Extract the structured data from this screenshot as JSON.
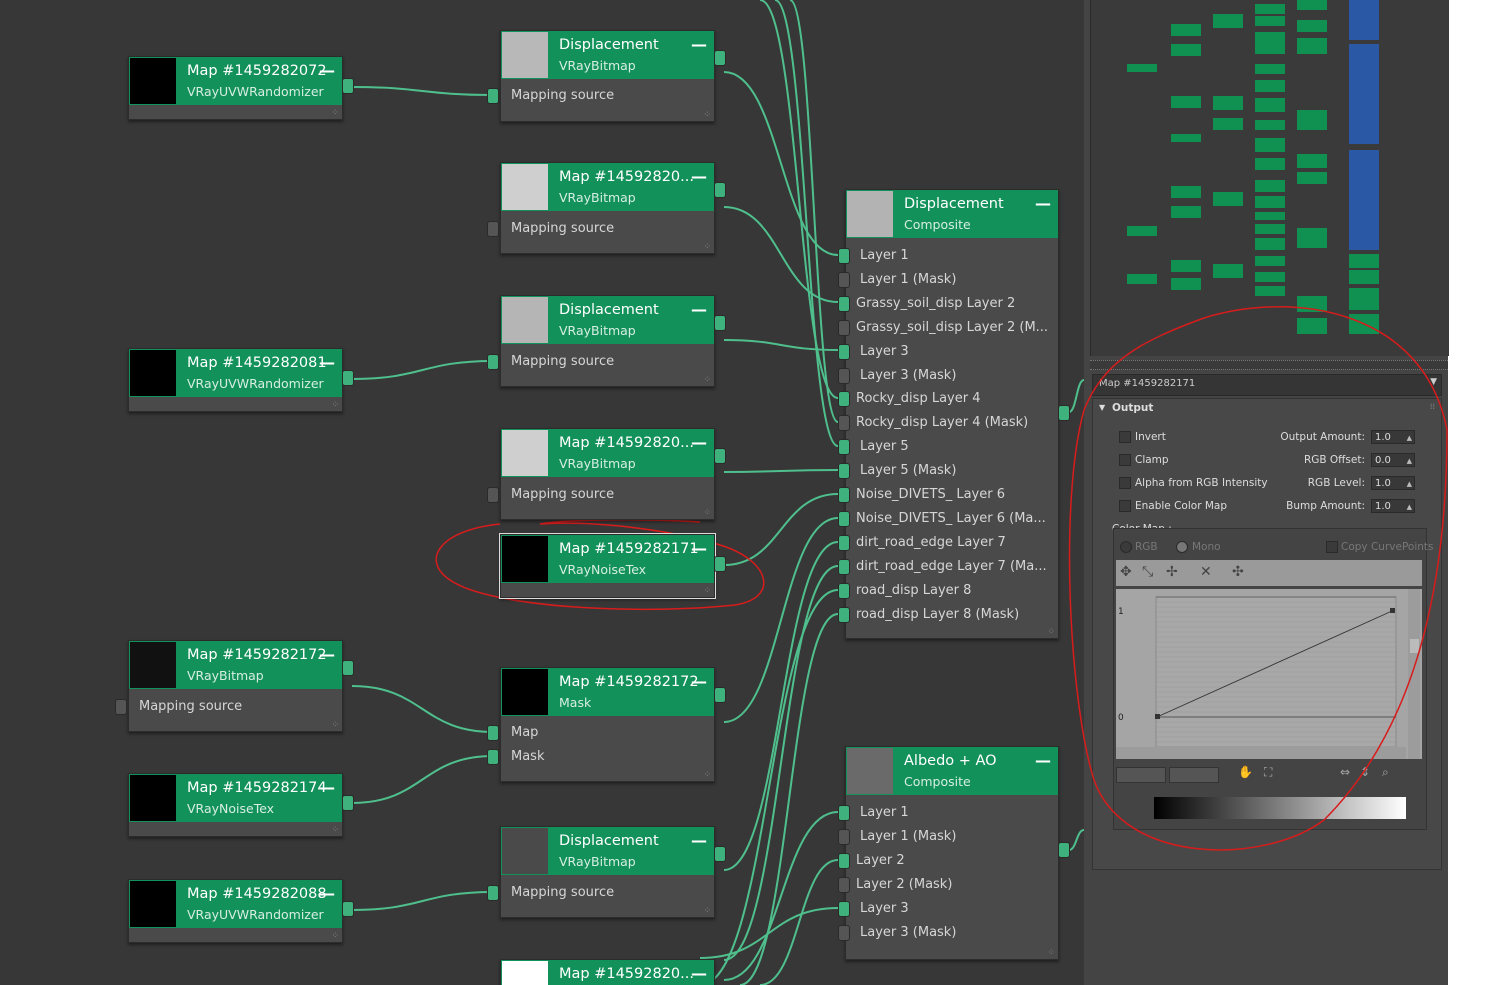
{
  "nodes": [
    {
      "title": "Map #1459282072",
      "subtitle": "VRayUVWRandomizer",
      "rows": []
    },
    {
      "title": "Displacement",
      "subtitle": "VRayBitmap",
      "rows": [
        "Mapping source"
      ]
    },
    {
      "title": "Map #14592820...",
      "subtitle": "VRayBitmap",
      "rows": [
        "Mapping source"
      ]
    },
    {
      "title": "Displacement",
      "subtitle": "VRayBitmap",
      "rows": [
        "Mapping source"
      ]
    },
    {
      "title": "Map #1459282081",
      "subtitle": "VRayUVWRandomizer",
      "rows": []
    },
    {
      "title": "Map #14592820...",
      "subtitle": "VRayBitmap",
      "rows": [
        "Mapping source"
      ]
    },
    {
      "title": "Map #1459282171",
      "subtitle": "VRayNoiseTex",
      "rows": []
    },
    {
      "title": "Map #1459282172",
      "subtitle": "VRayBitmap",
      "rows": [
        "Mapping source"
      ]
    },
    {
      "title": "Map #1459282172",
      "subtitle": "Mask",
      "rows": [
        "Map",
        "Mask"
      ]
    },
    {
      "title": "Map #1459282174",
      "subtitle": "VRayNoiseTex",
      "rows": []
    },
    {
      "title": "Displacement",
      "subtitle": "VRayBitmap",
      "rows": [
        "Mapping source"
      ]
    },
    {
      "title": "Map #1459282088",
      "subtitle": "VRayUVWRandomizer",
      "rows": []
    },
    {
      "title": "Map #14592820...",
      "subtitle": "",
      "rows": []
    },
    {
      "title": "Displacement",
      "subtitle": "Composite",
      "rows": [
        "Layer 1",
        "Layer 1 (Mask)",
        "Grassy_soil_disp Layer 2",
        "Grassy_soil_disp Layer 2 (M...",
        "Layer 3",
        "Layer 3 (Mask)",
        "Rocky_disp Layer 4",
        "Rocky_disp Layer 4 (Mask)",
        "Layer 5",
        "Layer 5 (Mask)",
        "Noise_DIVETS_ Layer 6",
        "Noise_DIVETS_ Layer 6 (Ma...",
        "dirt_road_edge Layer 7",
        "dirt_road_edge Layer 7 (Ma...",
        "road_disp Layer 8",
        "road_disp Layer 8 (Mask)"
      ]
    },
    {
      "title": "Albedo + AO",
      "subtitle": "Composite",
      "rows": [
        "Layer 1",
        "Layer 1 (Mask)",
        "Layer 2",
        "Layer 2 (Mask)",
        "Layer 3",
        "Layer 3 (Mask)"
      ]
    }
  ],
  "panel": {
    "title": "Map #1459282171",
    "rollout": "Output",
    "checkboxes": [
      "Invert",
      "Clamp",
      "Alpha from RGB Intensity",
      "Enable Color Map"
    ],
    "spinners": [
      {
        "label": "Output Amount:",
        "value": "1.0"
      },
      {
        "label": "RGB Offset:",
        "value": "0.0"
      },
      {
        "label": "RGB Level:",
        "value": "1.0"
      },
      {
        "label": "Bump Amount:",
        "value": "1.0"
      }
    ],
    "color_map_label": "Color Map :",
    "radio_rgb": "RGB",
    "radio_mono": "Mono",
    "copy_curve": "Copy CurvePoints",
    "axis_top": "1",
    "axis_bottom": "0"
  },
  "colors": {
    "header": "#13915a",
    "socket": "#3fb17c",
    "wire": "#4fc08d",
    "annotation": "#d81c1c"
  }
}
